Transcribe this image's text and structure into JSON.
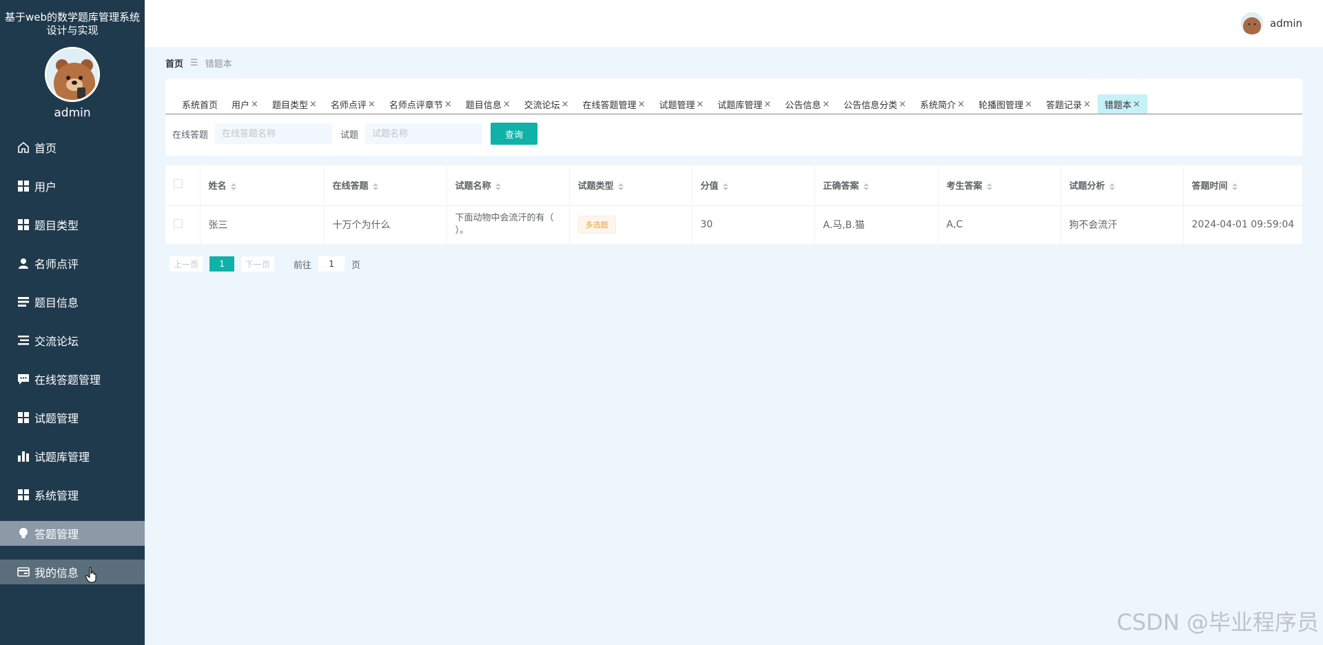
{
  "sidebar": {
    "system_title": "基于web的数学题库管理系统设计与实现",
    "username": "admin",
    "items": [
      {
        "label": "首页"
      },
      {
        "label": "用户"
      },
      {
        "label": "题目类型"
      },
      {
        "label": "名师点评"
      },
      {
        "label": "题目信息"
      },
      {
        "label": "交流论坛"
      },
      {
        "label": "在线答题管理"
      },
      {
        "label": "试题管理"
      },
      {
        "label": "试题库管理"
      },
      {
        "label": "系统管理"
      },
      {
        "label": "答题管理"
      },
      {
        "label": "我的信息"
      }
    ]
  },
  "header": {
    "username": "admin"
  },
  "breadcrumb": {
    "home": "首页",
    "current": "错题本"
  },
  "tabs": [
    "系统首页",
    "用户",
    "题目类型",
    "名师点评",
    "名师点评章节",
    "题目信息",
    "交流论坛",
    "在线答题管理",
    "试题管理",
    "试题库管理",
    "公告信息",
    "公告信息分类",
    "系统简介",
    "轮播图管理",
    "答题记录",
    "错题本"
  ],
  "search": {
    "label1": "在线答题",
    "placeholder1": "在线答题名称",
    "label2": "试题",
    "placeholder2": "试题名称",
    "button": "查询"
  },
  "table": {
    "columns": [
      "姓名",
      "在线答题",
      "试题名称",
      "试题类型",
      "分值",
      "正确答案",
      "考生答案",
      "试题分析",
      "答题时间"
    ],
    "rows": [
      {
        "name": "张三",
        "online": "十万个为什么",
        "question": "下面动物中会流汗的有（ ）。",
        "type": "多选题",
        "score": "30",
        "correct": "A.马,B.猫",
        "answer": "A,C",
        "analysis": "狗不会流汗",
        "time": "2024-04-01 09:59:04"
      }
    ]
  },
  "pagination": {
    "prev": "上一页",
    "page": "1",
    "next": "下一页",
    "goto": "前往",
    "goto_value": "1",
    "unit": "页"
  },
  "watermark": "CSDN @毕业程序员"
}
